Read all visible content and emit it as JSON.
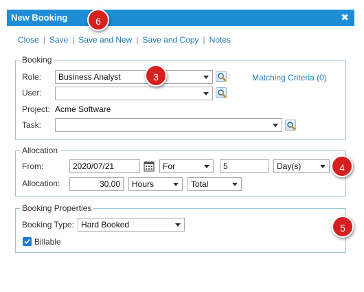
{
  "window": {
    "title": "New Booking",
    "close_glyph": "✖"
  },
  "toolbar": {
    "items": [
      "Close",
      "Save",
      "Save and New",
      "Save and Copy",
      "Notes"
    ],
    "separator": "|"
  },
  "booking": {
    "legend": "Booking",
    "role_label": "Role:",
    "role_value": "Business Analyst",
    "user_label": "User:",
    "user_value": "",
    "project_label": "Project:",
    "project_value": "Acme Software",
    "task_label": "Task:",
    "task_value": "",
    "matching_criteria": "Matching Criteria (0)",
    "role_colon": ":"
  },
  "allocation": {
    "legend": "Allocation",
    "from_label": "From:",
    "from_value": "2020/07/21",
    "for_value": "For",
    "count_value": "5",
    "unit_value": "Day(s)",
    "allocation_label": "Allocation:",
    "amount_value": "30.00",
    "amount_unit": "Hours",
    "amount_scope": "Total"
  },
  "booking_properties": {
    "legend": "Booking Properties",
    "type_label": "Booking Type:",
    "type_value": "Hard Booked",
    "billable_label": "Billable",
    "billable_checked": true
  },
  "markers": [
    "6",
    "3",
    "4",
    "5"
  ],
  "colors": {
    "titlebar": "#1f8dd6",
    "link": "#1f7ab8",
    "marker": "#d61f1f",
    "fieldset_border": "#9ec3dd"
  },
  "icons": [
    "close-icon",
    "search-icon",
    "calendar-icon",
    "chevron-down-icon",
    "checkmark-icon"
  ]
}
